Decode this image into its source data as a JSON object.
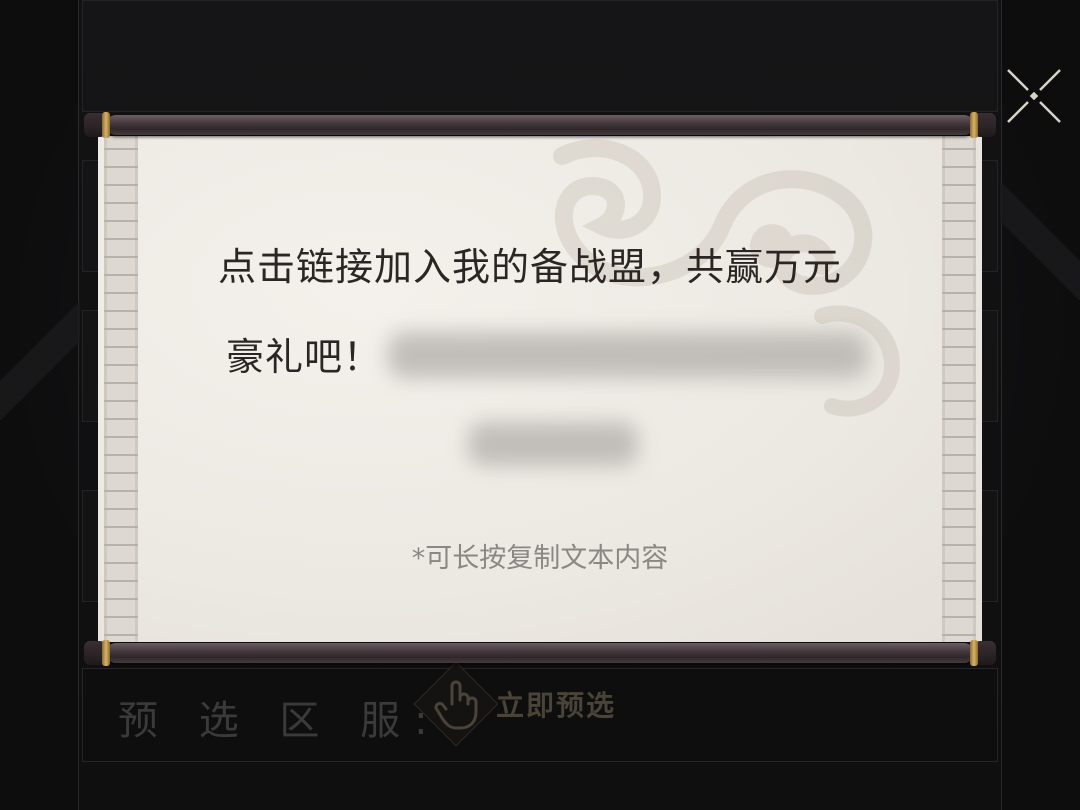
{
  "dialog": {
    "message_line1": "点击链接加入我的备战盟，共赢万元",
    "message_line2": "豪礼吧！",
    "hint": "*可长按复制文本内容"
  },
  "background": {
    "region_label": "预 选 区 服:",
    "preselect_button": "立即预选"
  },
  "icons": {
    "close": "close-icon",
    "hand": "hand-pointer-icon"
  },
  "colors": {
    "paper": "#ece8e2",
    "text": "#2b2624",
    "hint": "#8c8784",
    "rod": "#4a3e43",
    "gold": "#d9b46a"
  }
}
